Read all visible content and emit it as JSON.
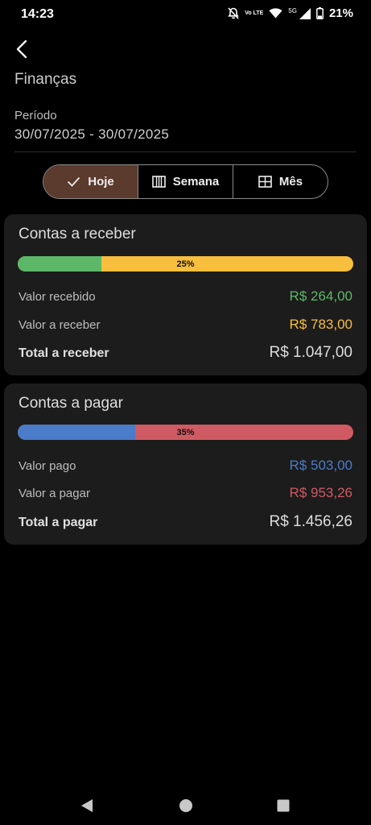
{
  "status_bar": {
    "time": "14:23",
    "network_label": "5G",
    "volte_label": "Vo LTE",
    "battery": "21%",
    "icons": [
      "mute-bell-icon",
      "volte-icon",
      "wifi-icon",
      "signal-icon",
      "battery-icon"
    ]
  },
  "header": {
    "back_icon": "chevron-left-icon",
    "title": "Finanças"
  },
  "period": {
    "label": "Período",
    "value": "30/07/2025 - 30/07/2025"
  },
  "segments": [
    {
      "label": "Hoje",
      "icon": "check-icon",
      "selected": true
    },
    {
      "label": "Semana",
      "icon": "week-grid-icon",
      "selected": false
    },
    {
      "label": "Mês",
      "icon": "month-grid-icon",
      "selected": false
    }
  ],
  "receivables": {
    "title": "Contas a receber",
    "progress": {
      "percent": 25,
      "label": "25%"
    },
    "rows": [
      {
        "label": "Valor recebido",
        "value": "R$ 264,00"
      },
      {
        "label": "Valor a receber",
        "value": "R$ 783,00"
      }
    ],
    "total": {
      "label": "Total a receber",
      "value": "R$ 1.047,00"
    }
  },
  "payables": {
    "title": "Contas a pagar",
    "progress": {
      "percent": 35,
      "label": "35%"
    },
    "rows": [
      {
        "label": "Valor pago",
        "value": "R$ 503,00"
      },
      {
        "label": "Valor a pagar",
        "value": "R$ 953,26"
      }
    ],
    "total": {
      "label": "Total a pagar",
      "value": "R$ 1.456,26"
    }
  },
  "colors": {
    "background": "#000000",
    "card": "#1c1c1c",
    "received": "#5cb868",
    "to_receive": "#f7bf3d",
    "paid": "#4a7cc9",
    "to_pay": "#d05a63",
    "segment_active": "#5b3b2d"
  },
  "nav_bar": {
    "icons": [
      "back-triangle-icon",
      "home-circle-icon",
      "recents-square-icon"
    ]
  }
}
